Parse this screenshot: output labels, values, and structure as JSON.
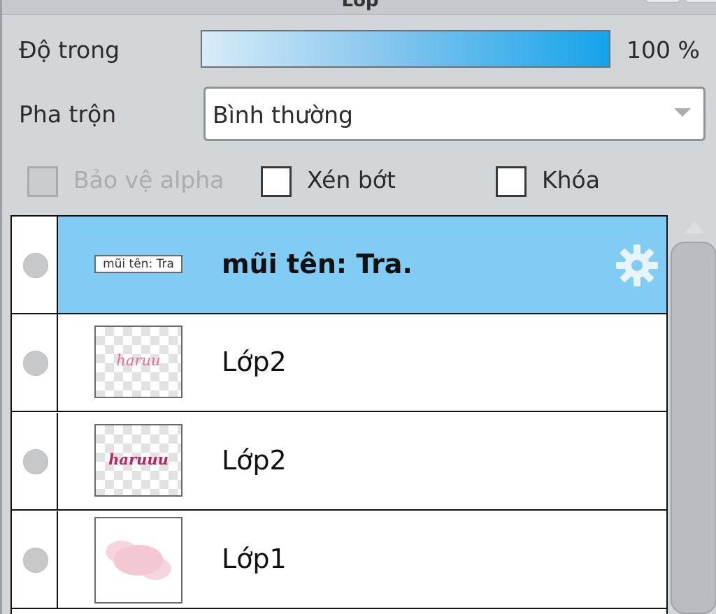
{
  "panel": {
    "title": "Lớp"
  },
  "properties": {
    "opacity_label": "Độ trong",
    "opacity_value": "100 %",
    "opacity_fraction": 1.0,
    "blend_label": "Pha trộn",
    "blend_value": "Bình thường"
  },
  "checkboxes": [
    {
      "label": "Bảo vệ alpha",
      "checked": false,
      "disabled": true
    },
    {
      "label": "Xén bớt",
      "checked": false,
      "disabled": false
    },
    {
      "label": "Khóa",
      "checked": false,
      "disabled": false
    }
  ],
  "layers": [
    {
      "name": "mũi tên: Tra.",
      "thumb_text": "mũi tên: Tra",
      "selected": true,
      "has_settings": true
    },
    {
      "name": "Lớp2",
      "thumb_text": "haruu",
      "selected": false
    },
    {
      "name": "Lớp2",
      "thumb_text": "haruuu",
      "selected": false
    },
    {
      "name": "Lớp1",
      "thumb_text": "",
      "selected": false
    }
  ],
  "icons": {
    "settings": "gear-icon",
    "visibility": "visibility-dot-icon",
    "dropdown": "chevron-down-icon",
    "scroll_up": "scroll-up-arrow-icon"
  },
  "colors": {
    "selected_row": "#80ccf5",
    "opacity_bar_end": "#15a3ea",
    "thumb_text_light": "#e46a9c",
    "thumb_text_dark": "#b8245f"
  }
}
